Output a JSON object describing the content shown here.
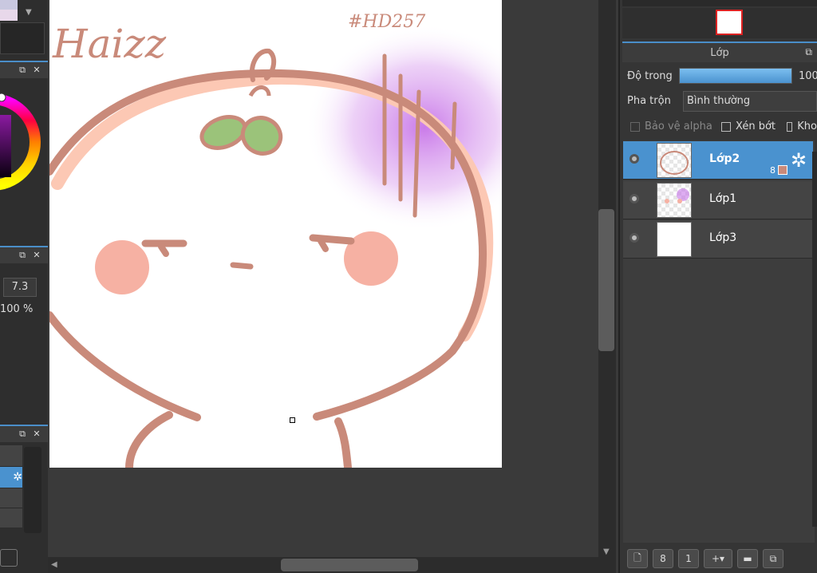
{
  "left": {
    "brush_size": "7.3",
    "opacity": "100 %"
  },
  "canvas": {
    "handwriting": "Haizz",
    "corner_text": "#HD257"
  },
  "layers_panel": {
    "title": "Lớp",
    "opacity_label": "Độ trong",
    "opacity_value": "100",
    "opacity_fill": 1.0,
    "blend_label": "Pha trộn",
    "blend_value": "Bình thường",
    "protect_alpha": "Bảo vệ alpha",
    "clipping": "Xén bớt",
    "lock": "Kho",
    "layers": [
      {
        "name": "Lớp2",
        "active": true,
        "badge": "8"
      },
      {
        "name": "Lớp1",
        "active": false
      },
      {
        "name": "Lớp3",
        "active": false
      }
    ]
  },
  "colors": {
    "accent": "#4a92cf",
    "stroke": "#c98a7a",
    "cheek": "#f6b1a3",
    "leaf": "#9bc37a",
    "purple": "#c774e8"
  }
}
